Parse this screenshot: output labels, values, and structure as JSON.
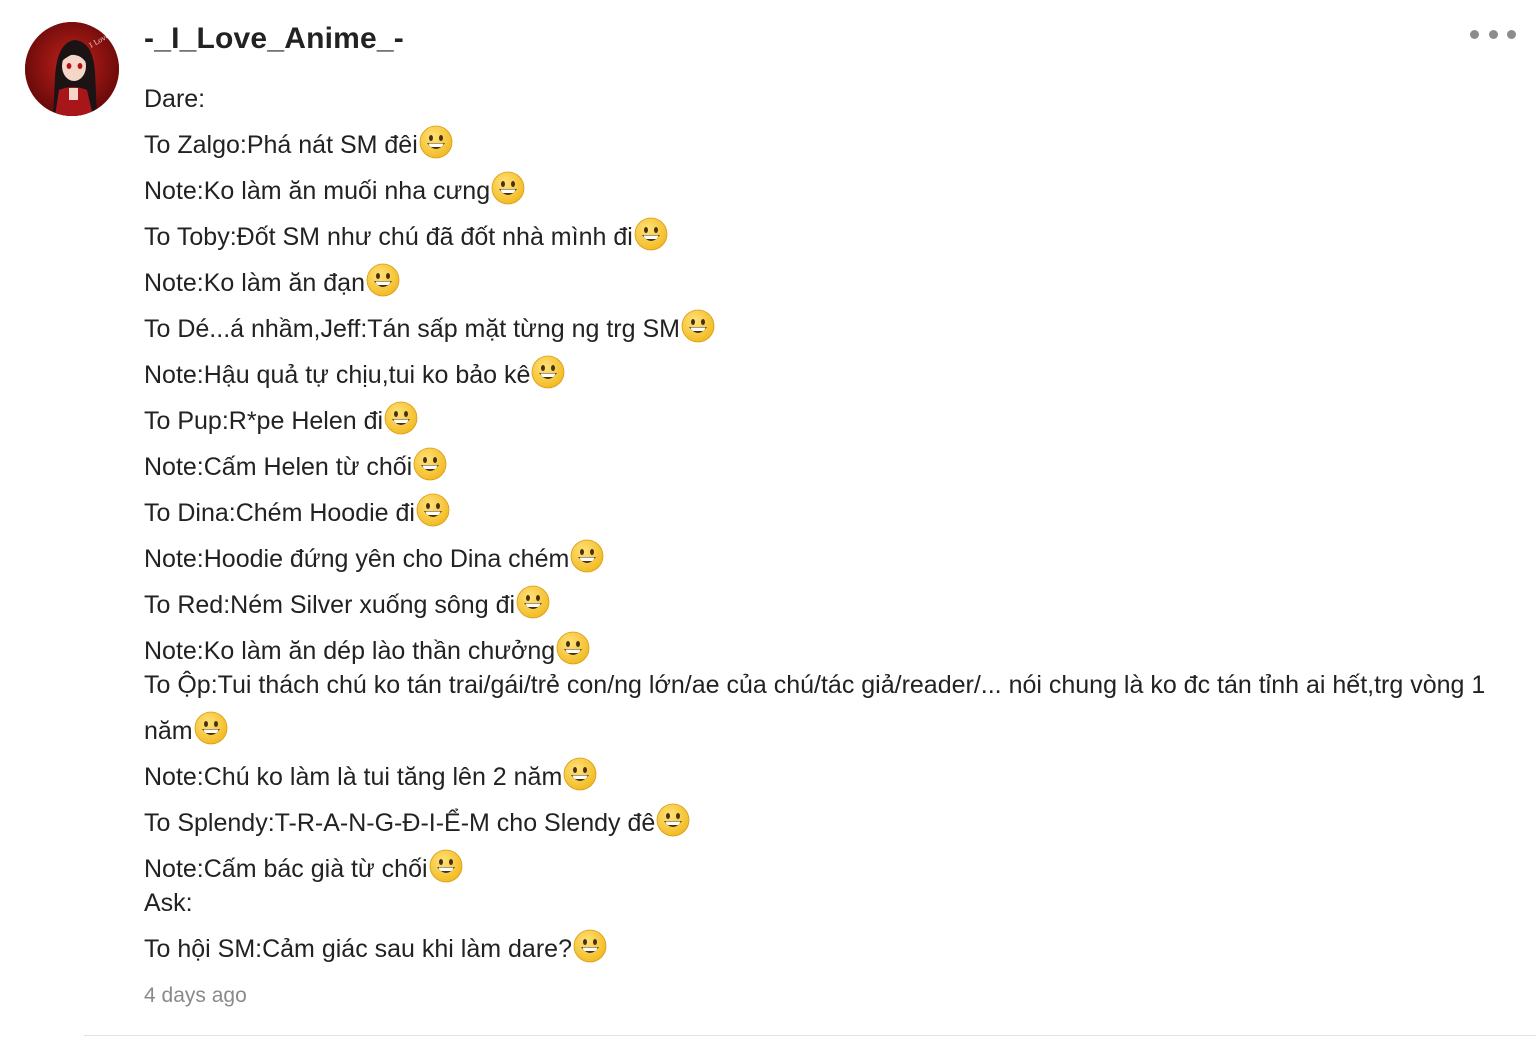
{
  "comment": {
    "username": "-_I_Love_Anime_-",
    "avatar": "avatar-image",
    "more_icon": "more-horizontal-icon",
    "emoji_icon": "grinning-face-emoji",
    "lines": [
      {
        "text": "Dare:",
        "emoji": false
      },
      {
        "text": "To Zalgo:Phá nát SM đêi",
        "emoji": true
      },
      {
        "text": "Note:Ko làm ăn muối nha cưng",
        "emoji": true
      },
      {
        "text": "To Toby:Đốt SM như chú đã đốt nhà mình đi",
        "emoji": true
      },
      {
        "text": "Note:Ko làm ăn đạn",
        "emoji": true
      },
      {
        "text": "To Dé...á nhầm,Jeff:Tán sấp mặt từng ng trg SM",
        "emoji": true
      },
      {
        "text": "Note:Hậu quả tự chịu,tui ko bảo kê",
        "emoji": true
      },
      {
        "text": "To Pup:R*pe Helen đi",
        "emoji": true
      },
      {
        "text": "Note:Cấm Helen từ chối",
        "emoji": true
      },
      {
        "text": "To Dina:Chém Hoodie đi",
        "emoji": true
      },
      {
        "text": "Note:Hoodie đứng yên cho Dina chém",
        "emoji": true
      },
      {
        "text": "To Red:Ném Silver xuống sông đi",
        "emoji": true
      },
      {
        "text": "Note:Ko làm ăn dép lào thần chưởng",
        "emoji": true
      },
      {
        "text": "To Ộp:Tui thách chú ko tán trai/gái/trẻ con/ng lớn/ae của chú/tác giả/reader/... nói chung là ko đc tán tỉnh ai hết,trg vòng 1 năm",
        "emoji": true
      },
      {
        "text": "Note:Chú ko làm là tui tăng lên 2 năm",
        "emoji": true
      },
      {
        "text": "To Splendy:T-R-A-N-G-Đ-I-Ể-M cho Slendy đê",
        "emoji": true
      },
      {
        "text": "Note:Cấm bác già từ chối",
        "emoji": true
      },
      {
        "text": "Ask:",
        "emoji": false
      },
      {
        "text": "To hội SM:Cảm giác sau khi làm dare?",
        "emoji": true
      }
    ],
    "timestamp": "4 days ago"
  },
  "colors": {
    "text": "#222222",
    "muted": "#8a8a8a",
    "divider": "#e2e2e2",
    "emoji_face": "#f7c531"
  }
}
